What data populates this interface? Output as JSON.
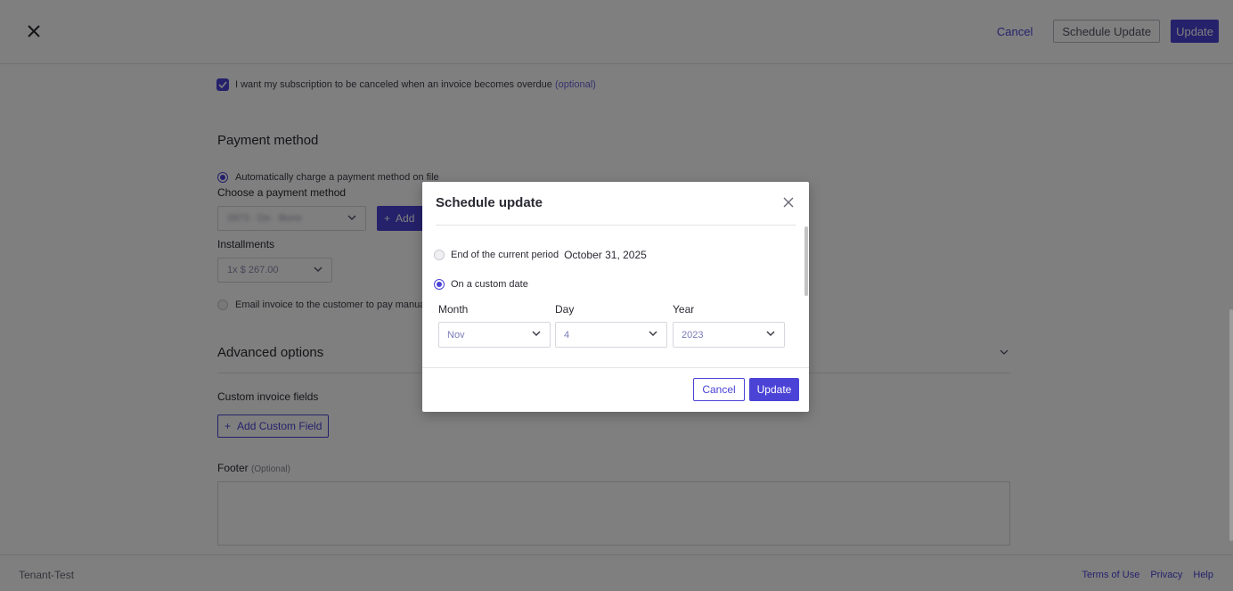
{
  "header": {
    "cancel_label": "Cancel",
    "schedule_update_label": "Schedule Update",
    "update_label": "Update"
  },
  "form": {
    "cancel_overdue_label": "I want my subscription to be canceled when an invoice becomes overdue",
    "cancel_overdue_optional": "(optional)",
    "cancel_overdue_checked": true,
    "payment_method_title": "Payment method",
    "auto_charge_label": "Automatically charge a payment method on file",
    "choose_method_label": "Choose a payment method",
    "choose_method_value": "0973 · Do · Bono",
    "add_label": "Add",
    "installments_label": "Installments",
    "installments_value": "1x $ 267.00",
    "email_invoice_label": "Email invoice to the customer to pay manually",
    "advanced_title": "Advanced options",
    "custom_fields_label": "Custom invoice fields",
    "add_custom_field_label": "Add Custom Field",
    "footer_label": "Footer",
    "footer_optional": "(Optional)"
  },
  "page_footer": {
    "tenant": "Tenant-Test",
    "links": [
      "Terms of Use",
      "Privacy",
      "Help"
    ]
  },
  "modal": {
    "title": "Schedule update",
    "option_end_label": "End of the current period",
    "option_end_date": "October 31, 2025",
    "option_custom_label": "On a custom date",
    "selected_option": "custom",
    "month_label": "Month",
    "day_label": "Day",
    "year_label": "Year",
    "month_value": "Nov",
    "day_value": "4",
    "year_value": "2023",
    "cancel_label": "Cancel",
    "update_label": "Update"
  },
  "icons": {
    "close": "close-icon",
    "chevron": "chevron-down-icon",
    "check": "check-icon",
    "plus": "plus-icon"
  },
  "colors": {
    "accent": "#4b43d6",
    "overlay": "rgba(0,0,0,0.5)"
  }
}
